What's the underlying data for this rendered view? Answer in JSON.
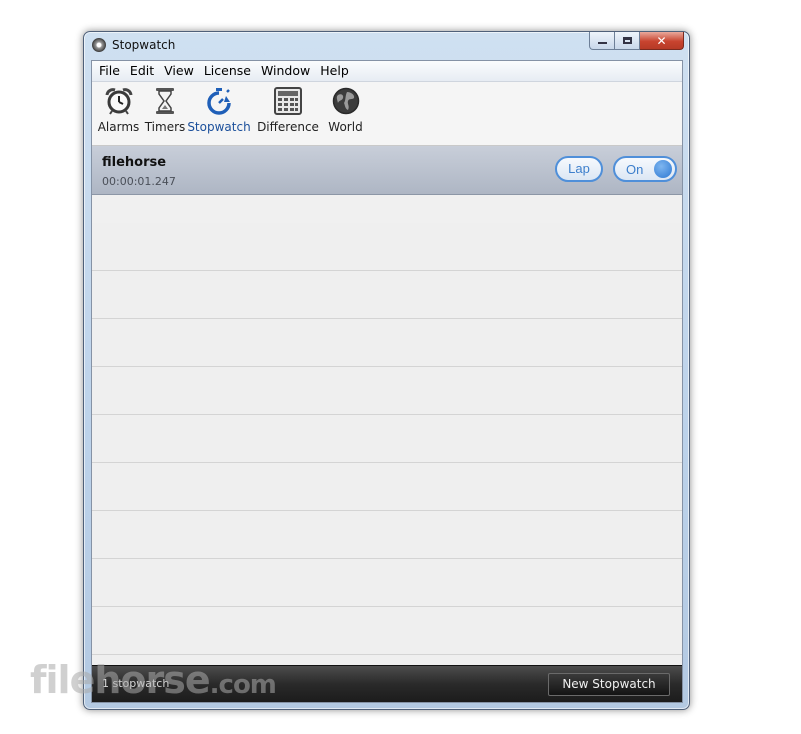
{
  "window": {
    "title": "Stopwatch"
  },
  "menu": [
    "File",
    "Edit",
    "View",
    "License",
    "Window",
    "Help"
  ],
  "toolbar": {
    "alarms": "Alarms",
    "timers": "Timers",
    "stopwatch": "Stopwatch",
    "difference": "Difference",
    "world": "World"
  },
  "stopwatch": {
    "name": "filehorse",
    "elapsed": "00:00:01.247",
    "lap_label": "Lap",
    "toggle_label": "On"
  },
  "status": {
    "count": "1 stopwatch",
    "new_button": "New Stopwatch"
  },
  "watermark": {
    "brand": "filehorse",
    "suffix": ".com"
  },
  "colors": {
    "accent": "#3d7fcc",
    "statusbar": "#2a2a2a"
  }
}
